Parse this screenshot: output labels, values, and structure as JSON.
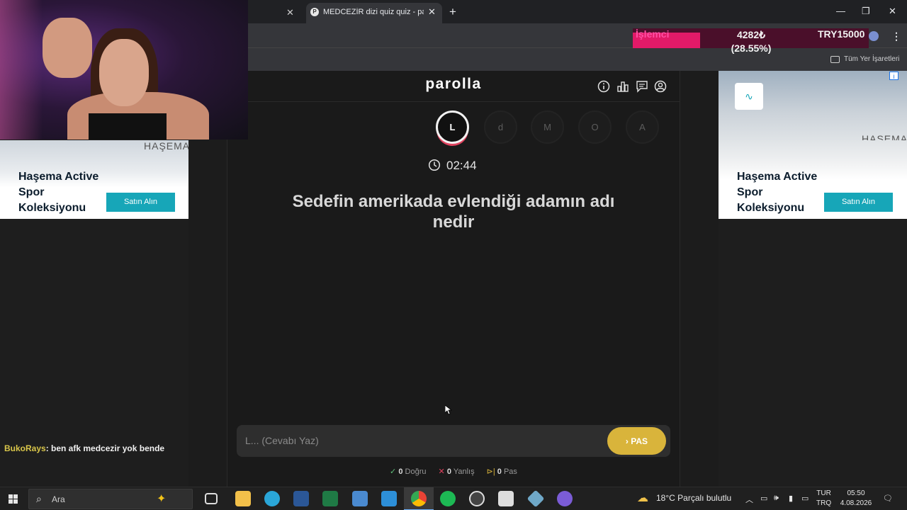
{
  "browser": {
    "tabs": [
      {
        "label": ""
      },
      {
        "label": "MEDCEZİR dizi quiz quiz - parolla",
        "active": true
      }
    ],
    "bookmarks_label": "Tüm Yer İşaretleri"
  },
  "cpu_overlay": {
    "label": "İşlemci",
    "value": "4282₺",
    "percent_text": "(28.55%)",
    "percent": 28.55,
    "money": "TRY15000"
  },
  "app": {
    "logo": "parolla",
    "header_icons": [
      "info-icon",
      "stats-icon",
      "comments-icon",
      "account-icon"
    ],
    "letters": [
      {
        "letter": "L",
        "active": true
      },
      {
        "letter": "d",
        "active": false
      },
      {
        "letter": "M",
        "active": false
      },
      {
        "letter": "O",
        "active": false
      },
      {
        "letter": "A",
        "active": false
      }
    ],
    "timer": "02:44",
    "question": "Sedefin amerikada evlendiği adamın adı nedir",
    "answer_placeholder": "L... (Cevabı Yaz)",
    "pass_button": "PAS",
    "stats": {
      "correct_count": "0",
      "correct_label": "Doğru",
      "wrong_count": "0",
      "wrong_label": "Yanlış",
      "pass_count": "0",
      "pass_label": "Pas"
    }
  },
  "ads": {
    "title": "Haşema Active Spor Koleksiyonu",
    "button": "Satın Alın",
    "brand": "HAŞEMA"
  },
  "chat": {
    "user": "BukoRays",
    "message": ": ben afk medcezir yok bende"
  },
  "taskbar": {
    "search_placeholder": "Ara",
    "weather": "18°C  Parçalı bulutlu",
    "lang_1": "TUR",
    "lang_2": "TRQ",
    "time": "05:50",
    "date": "4.08.2026",
    "accent_color": "#6fb4ff"
  },
  "colors": {
    "pass_button": "#d9b43b",
    "active_ring": "#e0435f",
    "ad_button": "#17a6b8"
  }
}
